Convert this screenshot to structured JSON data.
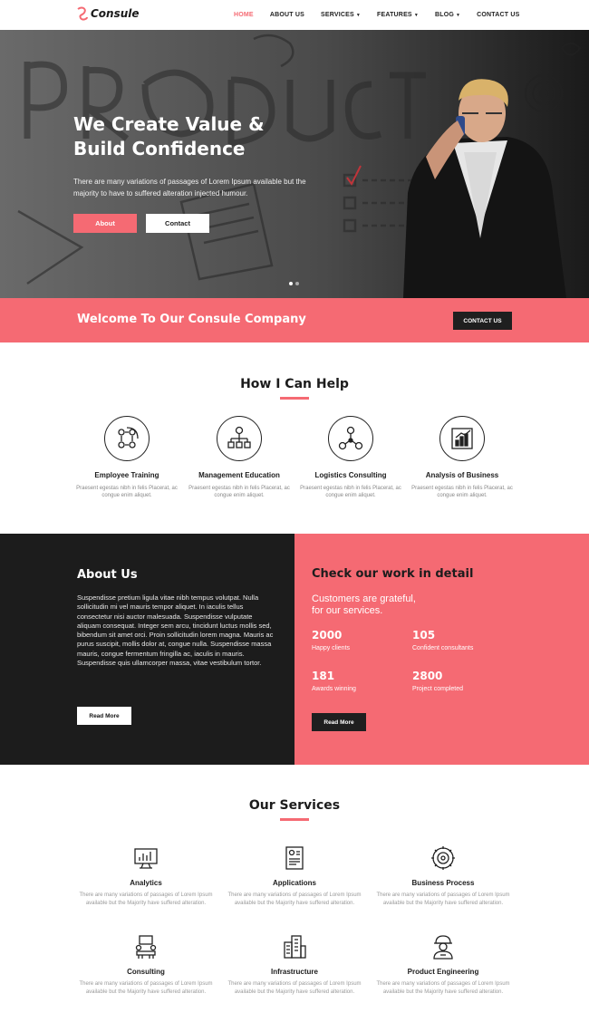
{
  "brand": {
    "name": "Consule",
    "accent": "#f56a73",
    "dark": "#1c1c1c"
  },
  "nav": {
    "items": [
      {
        "label": "HOME",
        "active": true
      },
      {
        "label": "ABOUT US"
      },
      {
        "label": "SERVICES",
        "dropdown": true
      },
      {
        "label": "FEATURES",
        "dropdown": true
      },
      {
        "label": "BLOG",
        "dropdown": true
      },
      {
        "label": "CONTACT US"
      }
    ]
  },
  "hero": {
    "title_line1": "We Create Value &",
    "title_line2": "Build Confidence",
    "text": "There are many variations of passages of Lorem Ipsum available but the majority to have to suffered alteration injected humour.",
    "btn_about": "About",
    "btn_contact": "Contact"
  },
  "welcome": {
    "text": "Welcome To Our Consule Company",
    "button": "CONTACT US"
  },
  "help": {
    "title": "How I Can Help",
    "items": [
      {
        "icon": "training-icon",
        "title": "Employee Training",
        "desc": "Praesent egestas nibh in felis Placerat, ac congue enim aliquet."
      },
      {
        "icon": "org-chart-icon",
        "title": "Management Education",
        "desc": "Praesent egestas nibh in felis Placerat, ac congue enim aliquet."
      },
      {
        "icon": "network-icon",
        "title": "Logistics Consulting",
        "desc": "Praesent egestas nibh in felis Placerat, ac congue enim aliquet."
      },
      {
        "icon": "bar-chart-icon",
        "title": "Analysis of Business",
        "desc": "Praesent egestas nibh in felis Placerat, ac congue enim aliquet."
      }
    ]
  },
  "about": {
    "title": "About Us",
    "text": "Suspendisse pretium ligula vitae nibh tempus volutpat. Nulla sollicitudin mi vel mauris tempor aliquet. In iaculis tellus consectetur nisi auctor malesuada. Suspendisse vulputate aliquam consequat. Integer sem arcu, tincidunt luctus mollis sed, bibendum sit amet orci. Proin sollicitudin lorem magna. Mauris ac purus suscipit, mollis dolor at, congue nulla. Suspendisse massa mauris, congue fermentum fringilla ac, iaculis in mauris. Suspendisse quis ullamcorper massa, vitae vestibulum tortor.",
    "button": "Read More"
  },
  "work": {
    "title": "Check our work in detail",
    "subtitle_line1": "Customers are grateful,",
    "subtitle_line2": "for our services.",
    "stats": [
      {
        "num": "2000",
        "label": "Happy clients"
      },
      {
        "num": "105",
        "label": "Confident consultants"
      },
      {
        "num": "181",
        "label": "Awards winning"
      },
      {
        "num": "2800",
        "label": "Project completed"
      }
    ],
    "button": "Read More"
  },
  "services": {
    "title": "Our Services",
    "items": [
      {
        "icon": "analytics-icon",
        "title": "Analytics",
        "desc": "There are many variations of passages of Lorem Ipsum available but the Majority have suffered alteration."
      },
      {
        "icon": "applications-icon",
        "title": "Applications",
        "desc": "There are many variations of passages of Lorem Ipsum available but the Majority have suffered alteration."
      },
      {
        "icon": "gear-icon",
        "title": "Business Process",
        "desc": "There are many variations of passages of Lorem Ipsum available but the Majority have suffered alteration."
      },
      {
        "icon": "meeting-icon",
        "title": "Consulting",
        "desc": "There are many variations of passages of Lorem Ipsum available but the Majority have suffered alteration."
      },
      {
        "icon": "building-icon",
        "title": "Infrastructure",
        "desc": "There are many variations of passages of Lorem Ipsum available but the Majority have suffered alteration."
      },
      {
        "icon": "engineer-icon",
        "title": "Product Engineering",
        "desc": "There are many variations of passages of Lorem Ipsum available but the Majority have suffered alteration."
      }
    ]
  }
}
